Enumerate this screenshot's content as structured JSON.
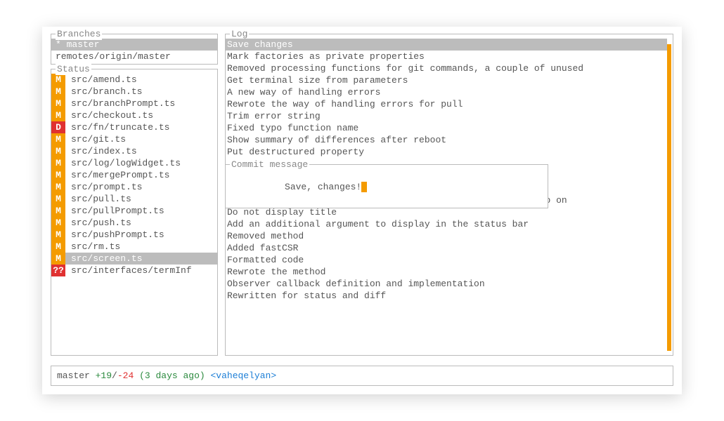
{
  "branches": {
    "title": "Branches",
    "items": [
      {
        "label": "* master",
        "selected": true
      },
      {
        "label": "remotes/origin/master",
        "selected": false
      }
    ]
  },
  "status": {
    "title": "Status",
    "items": [
      {
        "badge": "M",
        "style": "orange",
        "file": "src/amend.ts",
        "selected": false
      },
      {
        "badge": "M",
        "style": "orange",
        "file": "src/branch.ts",
        "selected": false
      },
      {
        "badge": "M",
        "style": "orange",
        "file": "src/branchPrompt.ts",
        "selected": false
      },
      {
        "badge": "M",
        "style": "orange",
        "file": "src/checkout.ts",
        "selected": false
      },
      {
        "badge": "D",
        "style": "red",
        "file": "src/fn/truncate.ts",
        "selected": false
      },
      {
        "badge": "M",
        "style": "orange",
        "file": "src/git.ts",
        "selected": false
      },
      {
        "badge": "M",
        "style": "orange",
        "file": "src/index.ts",
        "selected": false
      },
      {
        "badge": "M",
        "style": "orange",
        "file": "src/log/logWidget.ts",
        "selected": false
      },
      {
        "badge": "M",
        "style": "orange",
        "file": "src/mergePrompt.ts",
        "selected": false
      },
      {
        "badge": "M",
        "style": "orange",
        "file": "src/prompt.ts",
        "selected": false
      },
      {
        "badge": "M",
        "style": "orange",
        "file": "src/pull.ts",
        "selected": false
      },
      {
        "badge": "M",
        "style": "orange",
        "file": "src/pullPrompt.ts",
        "selected": false
      },
      {
        "badge": "M",
        "style": "orange",
        "file": "src/push.ts",
        "selected": false
      },
      {
        "badge": "M",
        "style": "orange",
        "file": "src/pushPrompt.ts",
        "selected": false
      },
      {
        "badge": "M",
        "style": "orange",
        "file": "src/rm.ts",
        "selected": false
      },
      {
        "badge": "M",
        "style": "orange",
        "file": "src/screen.ts",
        "selected": true
      },
      {
        "badge": "??",
        "style": "red",
        "file": "src/interfaces/termInf",
        "selected": false
      }
    ]
  },
  "log": {
    "title": "Log",
    "items": [
      {
        "msg": "Save changes",
        "selected": true
      },
      {
        "msg": "Mark factories as private properties"
      },
      {
        "msg": "Removed processing functions for git commands, a couple of unused"
      },
      {
        "msg": "Get terminal size from parameters"
      },
      {
        "msg": "A new way of handling errors"
      },
      {
        "msg": "Rewrote the way of handling errors for pull"
      },
      {
        "msg": "Trim error string"
      },
      {
        "msg": "Fixed typo function name"
      },
      {
        "msg": "Show summary of differences after reboot"
      },
      {
        "msg": "Put destructured property"
      },
      {
        "msg": "Processed the terminal option and rewrote the layout and so on"
      },
      {
        "msg": "Do not display title"
      },
      {
        "msg": "Add an additional argument to display in the status bar"
      },
      {
        "msg": "Removed method"
      },
      {
        "msg": "Added fastCSR"
      },
      {
        "msg": "Formatted code"
      },
      {
        "msg": "Rewrote the method"
      },
      {
        "msg": "Observer callback definition and implementation"
      },
      {
        "msg": "Rewritten for status and diff"
      }
    ],
    "gap_after_index": 9
  },
  "commit": {
    "title": "Commit message",
    "value": "Save, changes!"
  },
  "statusbar": {
    "branch": "master",
    "plus": "+19",
    "slash": "/",
    "minus": "-24",
    "age": "(3 days ago)",
    "author": "<vaheqelyan>"
  }
}
